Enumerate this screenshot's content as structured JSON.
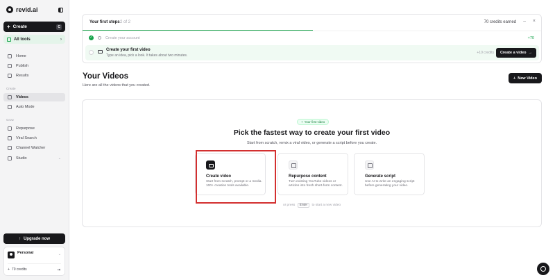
{
  "brand": {
    "name": "revid.ai"
  },
  "sidebar": {
    "create_label": "Create",
    "create_shortcut": "C",
    "all_tools_label": "All tools",
    "items_main": [
      {
        "label": "Home",
        "icon": "home-icon"
      },
      {
        "label": "Publish",
        "icon": "send-icon"
      },
      {
        "label": "Results",
        "icon": "chart-icon"
      }
    ],
    "section_create": "Create",
    "items_create": [
      {
        "label": "Videos",
        "icon": "video-icon",
        "active": true
      },
      {
        "label": "Auto Mode",
        "icon": "auto-icon"
      }
    ],
    "section_grow": "Grow",
    "items_grow": [
      {
        "label": "Repurpose",
        "icon": "repurpose-icon"
      },
      {
        "label": "Viral Search",
        "icon": "search-icon"
      },
      {
        "label": "Channel Watcher",
        "icon": "eye-icon"
      },
      {
        "label": "Studio",
        "icon": "studio-icon"
      }
    ],
    "upgrade_label": "Upgrade now",
    "account_name": "Personal",
    "credits": "70 credits"
  },
  "steps": {
    "title": "Your first steps",
    "count": "2 of 2",
    "credits_earned": "70 credits earned",
    "step1": {
      "label": "Create your account",
      "reward": "+70"
    },
    "step2": {
      "title": "Create your first video",
      "subtitle": "Type an idea, pick a look. It takes about two minutes.",
      "reward": "+10 credits",
      "button": "Create a video"
    }
  },
  "main": {
    "title": "Your Videos",
    "subtitle": "Here are all the videos that you created.",
    "new_video_label": "New Video"
  },
  "empty_state": {
    "pill": "Your first video",
    "title": "Pick the fastest way to create your first video",
    "subtitle": "Start from scratch, remix a viral video, or generate a script before you create.",
    "options": [
      {
        "title": "Create video",
        "desc": "Start from scratch, prompt or a media. 100+ creation tools available."
      },
      {
        "title": "Repurpose content",
        "desc": "Turn existing YouTube videos or articles into fresh short-form content."
      },
      {
        "title": "Generate script",
        "desc": "Use AI to write an engaging script before generating your video."
      }
    ],
    "hint_before": "or press",
    "hint_key": "Enter",
    "hint_after": "to start a new video"
  },
  "colors": {
    "accent": "#16a34a",
    "dark": "#18181b",
    "highlight": "#d32f2f"
  }
}
